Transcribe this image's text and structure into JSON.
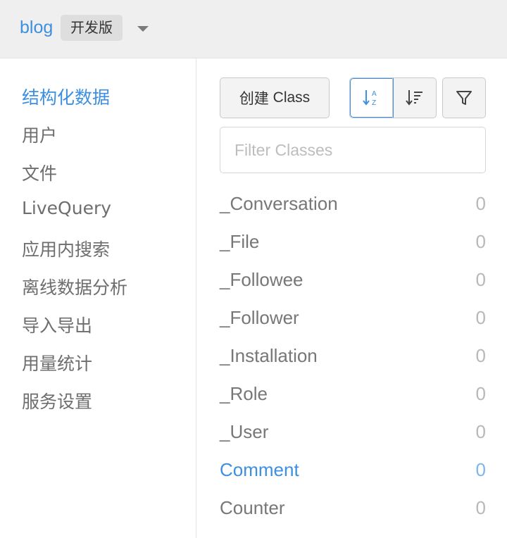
{
  "header": {
    "app_name": "blog",
    "env_label": "开发版"
  },
  "sidebar": {
    "items": [
      {
        "label": "结构化数据",
        "active": true
      },
      {
        "label": "用户"
      },
      {
        "label": "文件"
      },
      {
        "label": "LiveQuery"
      },
      {
        "label": "应用内搜索"
      },
      {
        "label": "离线数据分析"
      },
      {
        "label": "导入导出"
      },
      {
        "label": "用量统计"
      },
      {
        "label": "服务设置"
      }
    ]
  },
  "toolbar": {
    "create_label_cn": "创建",
    "create_label_en": "Class",
    "sort_az_icon": "sort-alpha-icon",
    "sort_count_icon": "sort-count-icon",
    "filter_icon": "funnel-icon"
  },
  "filter": {
    "placeholder": "Filter Classes",
    "value": ""
  },
  "classes": [
    {
      "name": "_Conversation",
      "count": "0"
    },
    {
      "name": "_File",
      "count": "0"
    },
    {
      "name": "_Followee",
      "count": "0"
    },
    {
      "name": "_Follower",
      "count": "0"
    },
    {
      "name": "_Installation",
      "count": "0"
    },
    {
      "name": "_Role",
      "count": "0"
    },
    {
      "name": "_User",
      "count": "0"
    },
    {
      "name": "Comment",
      "count": "0",
      "active": true
    },
    {
      "name": "Counter",
      "count": "0"
    }
  ],
  "colors": {
    "accent": "#3d8fe0",
    "topbar_bg": "#efefef"
  }
}
